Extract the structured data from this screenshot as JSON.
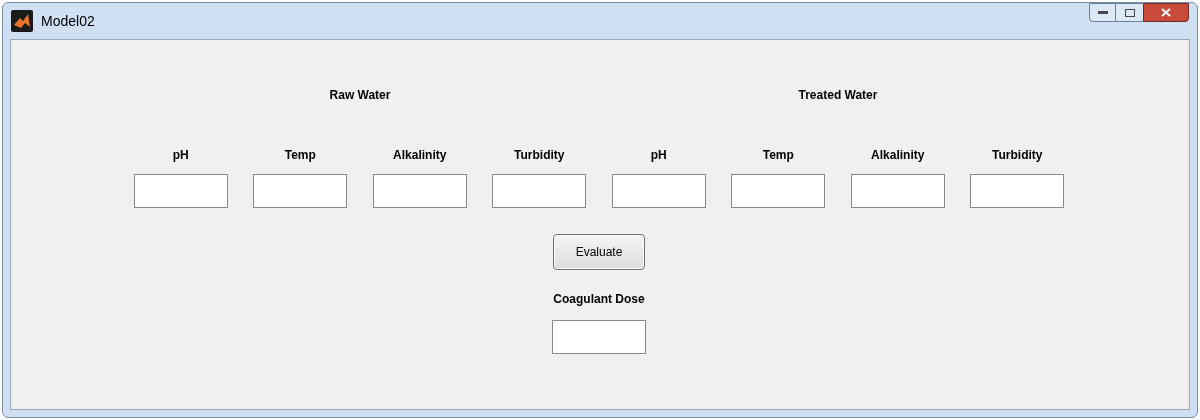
{
  "window": {
    "title": "Model02"
  },
  "groups": [
    {
      "heading": "Raw Water",
      "fields": [
        {
          "label": "pH"
        },
        {
          "label": "Temp"
        },
        {
          "label": "Alkalinity"
        },
        {
          "label": "Turbidity"
        }
      ]
    },
    {
      "heading": "Treated Water",
      "fields": [
        {
          "label": "pH"
        },
        {
          "label": "Temp"
        },
        {
          "label": "Alkalinity"
        },
        {
          "label": "Turbidity"
        }
      ]
    }
  ],
  "button": {
    "label": "Evaluate"
  },
  "output": {
    "label": "Coagulant Dose"
  }
}
